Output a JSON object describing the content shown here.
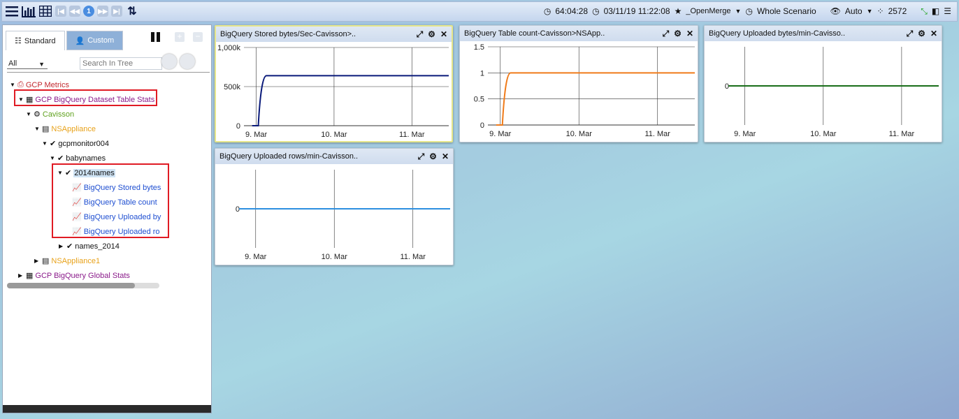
{
  "topbar": {
    "left_icons": [
      "menu-icon",
      "bar-chart-icon",
      "grid-icon",
      "first-page-icon",
      "prev-page-icon",
      "page-number",
      "next-page-icon",
      "last-page-icon",
      "sort-icon"
    ],
    "page_number": "1",
    "elapsed": "64:04:28",
    "datetime": "03/11/19 11:22:08",
    "favorite_label": "_OpenMerge",
    "scenario_label": "Whole Scenario",
    "view_mode": "Auto",
    "count": "2572"
  },
  "leftpanel": {
    "tab_standard": "Standard",
    "tab_custom": "Custom",
    "filter_value": "All",
    "search_placeholder": "Search In Tree",
    "tree": [
      {
        "label": "GCP Metrics"
      },
      {
        "label": "GCP BigQuery Dataset Table Stats"
      },
      {
        "label": "Cavisson"
      },
      {
        "label": "NSAppliance"
      },
      {
        "label": "gcpmonitor004"
      },
      {
        "label": "babynames"
      },
      {
        "label": "2014names"
      },
      {
        "label": "BigQuery Stored bytes"
      },
      {
        "label": "BigQuery Table count"
      },
      {
        "label": "BigQuery Uploaded by"
      },
      {
        "label": "BigQuery Uploaded ro"
      },
      {
        "label": "names_2014"
      },
      {
        "label": "NSAppliance1"
      },
      {
        "label": "GCP BigQuery Global Stats"
      }
    ]
  },
  "panels": [
    {
      "title": "BigQuery Stored bytes/Sec-Cavisson>.."
    },
    {
      "title": "BigQuery Table count-Cavisson>NSApp.."
    },
    {
      "title": "BigQuery Uploaded bytes/min-Cavisso.."
    },
    {
      "title": "BigQuery Uploaded rows/min-Cavisson.."
    }
  ],
  "chart_data": [
    {
      "type": "line",
      "title": "BigQuery Stored bytes/Sec-Cavisson>..",
      "yticks": [
        "1,000k",
        "500k",
        "0"
      ],
      "ylim": [
        0,
        1000
      ],
      "xticks": [
        "9. Mar",
        "10. Mar",
        "11. Mar"
      ],
      "x": [
        "start",
        "ramp",
        "9. Mar",
        "11. Mar",
        "end"
      ],
      "series": [
        {
          "color": "#0a1a7a",
          "values": [
            0,
            0,
            640,
            640,
            640
          ]
        }
      ]
    },
    {
      "type": "line",
      "title": "BigQuery Table count-Cavisson>NSApp..",
      "yticks": [
        "1.5",
        "1",
        "0.5",
        "0"
      ],
      "ylim": [
        0,
        1.5
      ],
      "xticks": [
        "9. Mar",
        "10. Mar",
        "11. Mar"
      ],
      "x": [
        "start",
        "ramp",
        "9. Mar",
        "11. Mar",
        "end"
      ],
      "series": [
        {
          "color": "#f07b1a",
          "values": [
            0,
            0,
            1,
            1,
            1
          ]
        }
      ]
    },
    {
      "type": "line",
      "title": "BigQuery Uploaded bytes/min-Cavisso..",
      "yticks": [
        "0"
      ],
      "ylim": [
        -1,
        1
      ],
      "xticks": [
        "9. Mar",
        "10. Mar",
        "11. Mar"
      ],
      "x": [
        "start",
        "end"
      ],
      "series": [
        {
          "color": "#1a6e1a",
          "values": [
            0,
            0
          ]
        }
      ]
    },
    {
      "type": "line",
      "title": "BigQuery Uploaded rows/min-Cavisson..",
      "yticks": [
        "0"
      ],
      "ylim": [
        -1,
        1
      ],
      "xticks": [
        "9. Mar",
        "10. Mar",
        "11. Mar"
      ],
      "x": [
        "start",
        "end"
      ],
      "series": [
        {
          "color": "#2d8fe0",
          "values": [
            0,
            0
          ]
        }
      ]
    }
  ]
}
